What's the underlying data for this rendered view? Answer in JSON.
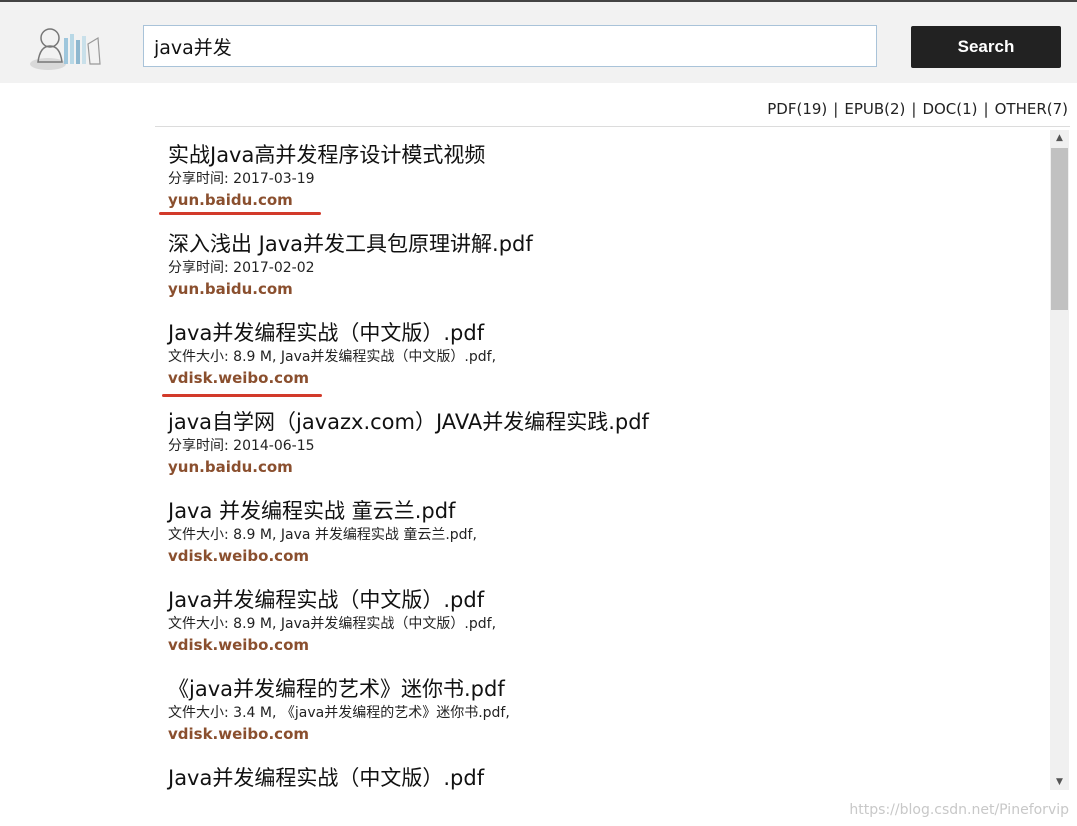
{
  "search": {
    "query": "java并发",
    "button_label": "Search"
  },
  "filters": [
    {
      "label": "PDF(19)"
    },
    {
      "label": "EPUB(2)"
    },
    {
      "label": "DOC(1)"
    },
    {
      "label": "OTHER(7)"
    }
  ],
  "filter_separator": "|",
  "results": [
    {
      "title": "实战Java高并发程序设计模式视频",
      "meta": "分享时间: 2017-03-19",
      "source": "yun.baidu.com"
    },
    {
      "title": "深入浅出 Java并发工具包原理讲解.pdf",
      "meta": "分享时间: 2017-02-02",
      "source": "yun.baidu.com"
    },
    {
      "title": "Java并发编程实战（中文版）.pdf",
      "meta": "文件大小: 8.9 M, Java并发编程实战（中文版）.pdf,",
      "source": "vdisk.weibo.com"
    },
    {
      "title": "java自学网（javazx.com）JAVA并发编程实践.pdf",
      "meta": "分享时间: 2014-06-15",
      "source": "yun.baidu.com"
    },
    {
      "title": "Java 并发编程实战 童云兰.pdf",
      "meta": "文件大小: 8.9 M, Java 并发编程实战 童云兰.pdf,",
      "source": "vdisk.weibo.com"
    },
    {
      "title": "Java并发编程实战（中文版）.pdf",
      "meta": "文件大小: 8.9 M, Java并发编程实战（中文版）.pdf,",
      "source": "vdisk.weibo.com"
    },
    {
      "title": "《java并发编程的艺术》迷你书.pdf",
      "meta": "文件大小: 3.4 M, 《java并发编程的艺术》迷你书.pdf,",
      "source": "vdisk.weibo.com"
    },
    {
      "title": "Java并发编程实战（中文版）.pdf",
      "meta": "",
      "source": ""
    }
  ],
  "watermark": "https://blog.csdn.net/Pineforvip",
  "colors": {
    "source_link": "#8a4f2e",
    "annotation_underline": "#d23a2a",
    "search_button": "#222222"
  },
  "icons": {
    "logo": "reading-baby-logo-icon",
    "scroll_up": "arrow-up-icon",
    "scroll_down": "arrow-down-icon"
  }
}
